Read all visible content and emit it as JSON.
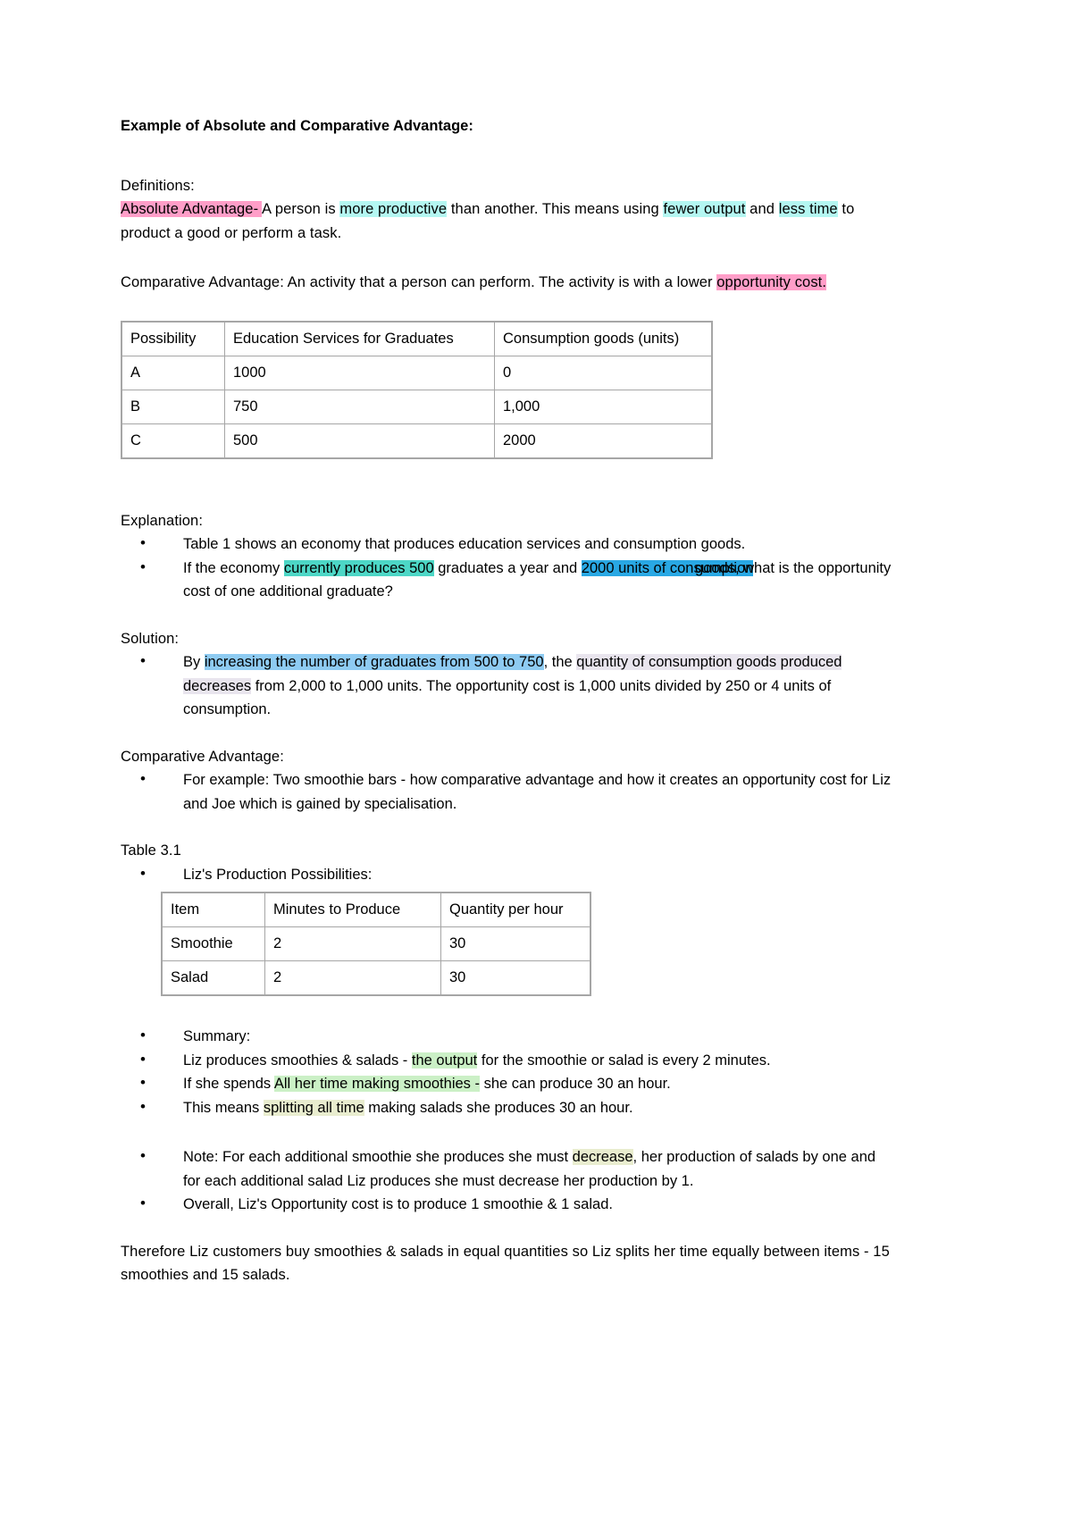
{
  "document": {
    "title": "Example of Absolute and Comparative Advantage:",
    "definitions_heading": "Definitions:",
    "absolute_advantage": {
      "term": "Absolute Advantage- ",
      "t1": " A person is ",
      "h1": "more productive",
      "t2": " than another. This means using ",
      "h2": "fewer output",
      "t3": " and ",
      "h3": "less time",
      "t4": " to product a good or perform a task."
    },
    "comparative_advantage": {
      "t1": "Comparative Advantage: An activity that a person can perform. The activity is with a lower ",
      "h1": "opportunity cost."
    },
    "table1": {
      "headers": [
        "Possibility",
        "Education Services for Graduates",
        "Consumption goods (units)"
      ],
      "rows": [
        [
          "A",
          "1000",
          "0"
        ],
        [
          "B",
          "750",
          "1,000"
        ],
        [
          "C",
          "500",
          "2000"
        ]
      ]
    },
    "explanation": {
      "heading": "Explanation:",
      "bullet1": "Table 1 shows an economy that produces education services and consumption goods.",
      "bullet2": {
        "t1": "If the economy ",
        "h1": "currently produces 500",
        "t2": " graduates a year and ",
        "h2": "2000 units of consumption",
        "t3": " goods, what is the opportunity cost of one additional graduate?"
      }
    },
    "solution": {
      "heading": "Solution:",
      "bullet1": {
        "t1": "By ",
        "h1": "increasing the number of graduates from 500 to 750",
        "t2": ", the ",
        "h2": "quantity of consumption goods produced decreases",
        "t3": " from 2,000 to 1,000 units.  The opportunity cost is 1,000 units divided by 250  or 4 units of consumption."
      }
    },
    "comparative_section": {
      "heading": "Comparative Advantage:",
      "bullet1": "For example: Two smoothie bars - how comparative advantage and how it creates an opportunity cost for Liz and Joe which is gained by specialisation."
    },
    "table3_label": "Table 3.1",
    "liz_heading": "Liz's Production Possibilities:",
    "table2": {
      "headers": [
        "Item",
        "Minutes to Produce",
        "Quantity per hour"
      ],
      "rows": [
        [
          "Smoothie",
          "2",
          "30"
        ],
        [
          "Salad",
          "2",
          "30"
        ]
      ]
    },
    "summary": {
      "heading": "Summary:",
      "bullet2": {
        "t1": "Liz produces smoothies & salads - ",
        "h1": "the output",
        "t2": " for the smoothie or salad is every 2 minutes."
      },
      "bullet3": {
        "t1": "If she spends ",
        "h1": "All her time making smoothies -",
        "t2": " she can produce 30 an hour."
      },
      "bullet4": {
        "t1": "This means ",
        "h1": "splitting all time",
        "t2": " making salads she produces 30 an hour."
      },
      "bullet5": {
        "t1": "Note: For each additional smoothie she produces she must ",
        "h1": "decrease",
        "t2": ", her production of salads by one and for each additional salad Liz produces she must decrease her production by 1."
      },
      "bullet6": "Overall, Liz's Opportunity cost is to produce 1 smoothie & 1 salad."
    },
    "closing": "Therefore Liz customers buy smoothies & salads in equal quantities so Liz splits her time equally between items - 15 smoothies and 15 salads."
  },
  "colors": {
    "pink": "#ff9ec8",
    "cyan": "#b4f7f2",
    "teal": "#4dd7c6",
    "blue": "#29a8e4",
    "light_blue": "#8ecbf2",
    "lavender": "#e9e5ee",
    "green": "#cbf0c6",
    "yellow_green": "#e9edcf",
    "table_border": "#a6a6a6"
  }
}
